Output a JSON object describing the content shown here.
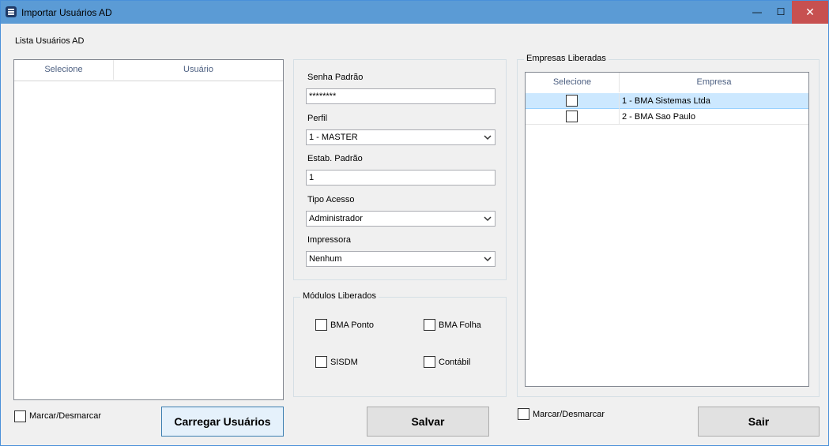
{
  "window": {
    "title": "Importar Usuários AD",
    "minimize_label": "—",
    "maximize_label": "☐",
    "close_label": "✕"
  },
  "left": {
    "title": "Lista Usuários AD",
    "columns": [
      "Selecione",
      "Usuário"
    ],
    "toggle_label": "Marcar/Desmarcar",
    "load_button": "Carregar Usuários"
  },
  "form": {
    "password_label": "Senha Padrão",
    "password_value": "********",
    "profile_label": "Perfil",
    "profile_value": "1 - MASTER",
    "estab_label": "Estab. Padrão",
    "estab_value": "1",
    "access_label": "Tipo Acesso",
    "access_value": "Administrador",
    "printer_label": "Impressora",
    "printer_value": "Nenhum"
  },
  "modules": {
    "legend": "Módulos Liberados",
    "items": [
      "BMA Ponto",
      "BMA Folha",
      "SISDM",
      "Contábil"
    ]
  },
  "save_button": "Salvar",
  "companies": {
    "legend": "Empresas Liberadas",
    "columns": [
      "Selecione",
      "Empresa"
    ],
    "rows": [
      {
        "name": "1 - BMA Sistemas Ltda",
        "checked": false
      },
      {
        "name": "2 - BMA Sao Paulo",
        "checked": false
      }
    ],
    "toggle_label": "Marcar/Desmarcar"
  },
  "exit_button": "Sair",
  "colors": {
    "titlebar": "#5b9bd5",
    "close": "#c75050",
    "selected_row": "#cce8ff"
  }
}
